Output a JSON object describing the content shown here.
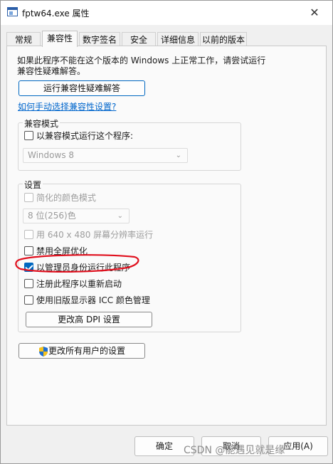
{
  "window": {
    "title": "fptw64.exe 属性",
    "close_glyph": "✕"
  },
  "tabs": [
    {
      "label": "常规"
    },
    {
      "label": "兼容性"
    },
    {
      "label": "数字签名"
    },
    {
      "label": "安全"
    },
    {
      "label": "详细信息"
    },
    {
      "label": "以前的版本"
    }
  ],
  "active_tab": "兼容性",
  "info_text": "如果此程序不能在这个版本的 Windows 上正常工作，请尝试运行兼容性疑难解答。",
  "troubleshoot_button": "运行兼容性疑难解答",
  "manual_link": "如何手动选择兼容性设置?",
  "compat_mode": {
    "group_label": "兼容模式",
    "checkbox_label": "以兼容模式运行这个程序:",
    "checked": false,
    "os_value": "Windows 8"
  },
  "settings": {
    "group_label": "设置",
    "reduced_color": {
      "label": "简化的颜色模式",
      "checked": false,
      "disabled": true
    },
    "color_value": "8 位(256)色",
    "res_640": {
      "label": "用 640 x 480 屏幕分辨率运行",
      "checked": false,
      "disabled": true
    },
    "disable_fullscreen": {
      "label": "禁用全屏优化",
      "checked": false
    },
    "run_as_admin": {
      "label": "以管理员身份运行此程序",
      "checked": true
    },
    "register_restart": {
      "label": "注册此程序以重新启动",
      "checked": false
    },
    "legacy_icc": {
      "label": "使用旧版显示器 ICC 颜色管理",
      "checked": false
    },
    "dpi_button": "更改高 DPI 设置"
  },
  "all_users_button": "更改所有用户的设置",
  "footer": {
    "ok": "确定",
    "cancel": "取消",
    "apply": "应用(A)"
  },
  "watermark": "CSDN @能遇见就是缘",
  "colors": {
    "accent": "#0067c0",
    "annotation": "#e0101e"
  }
}
